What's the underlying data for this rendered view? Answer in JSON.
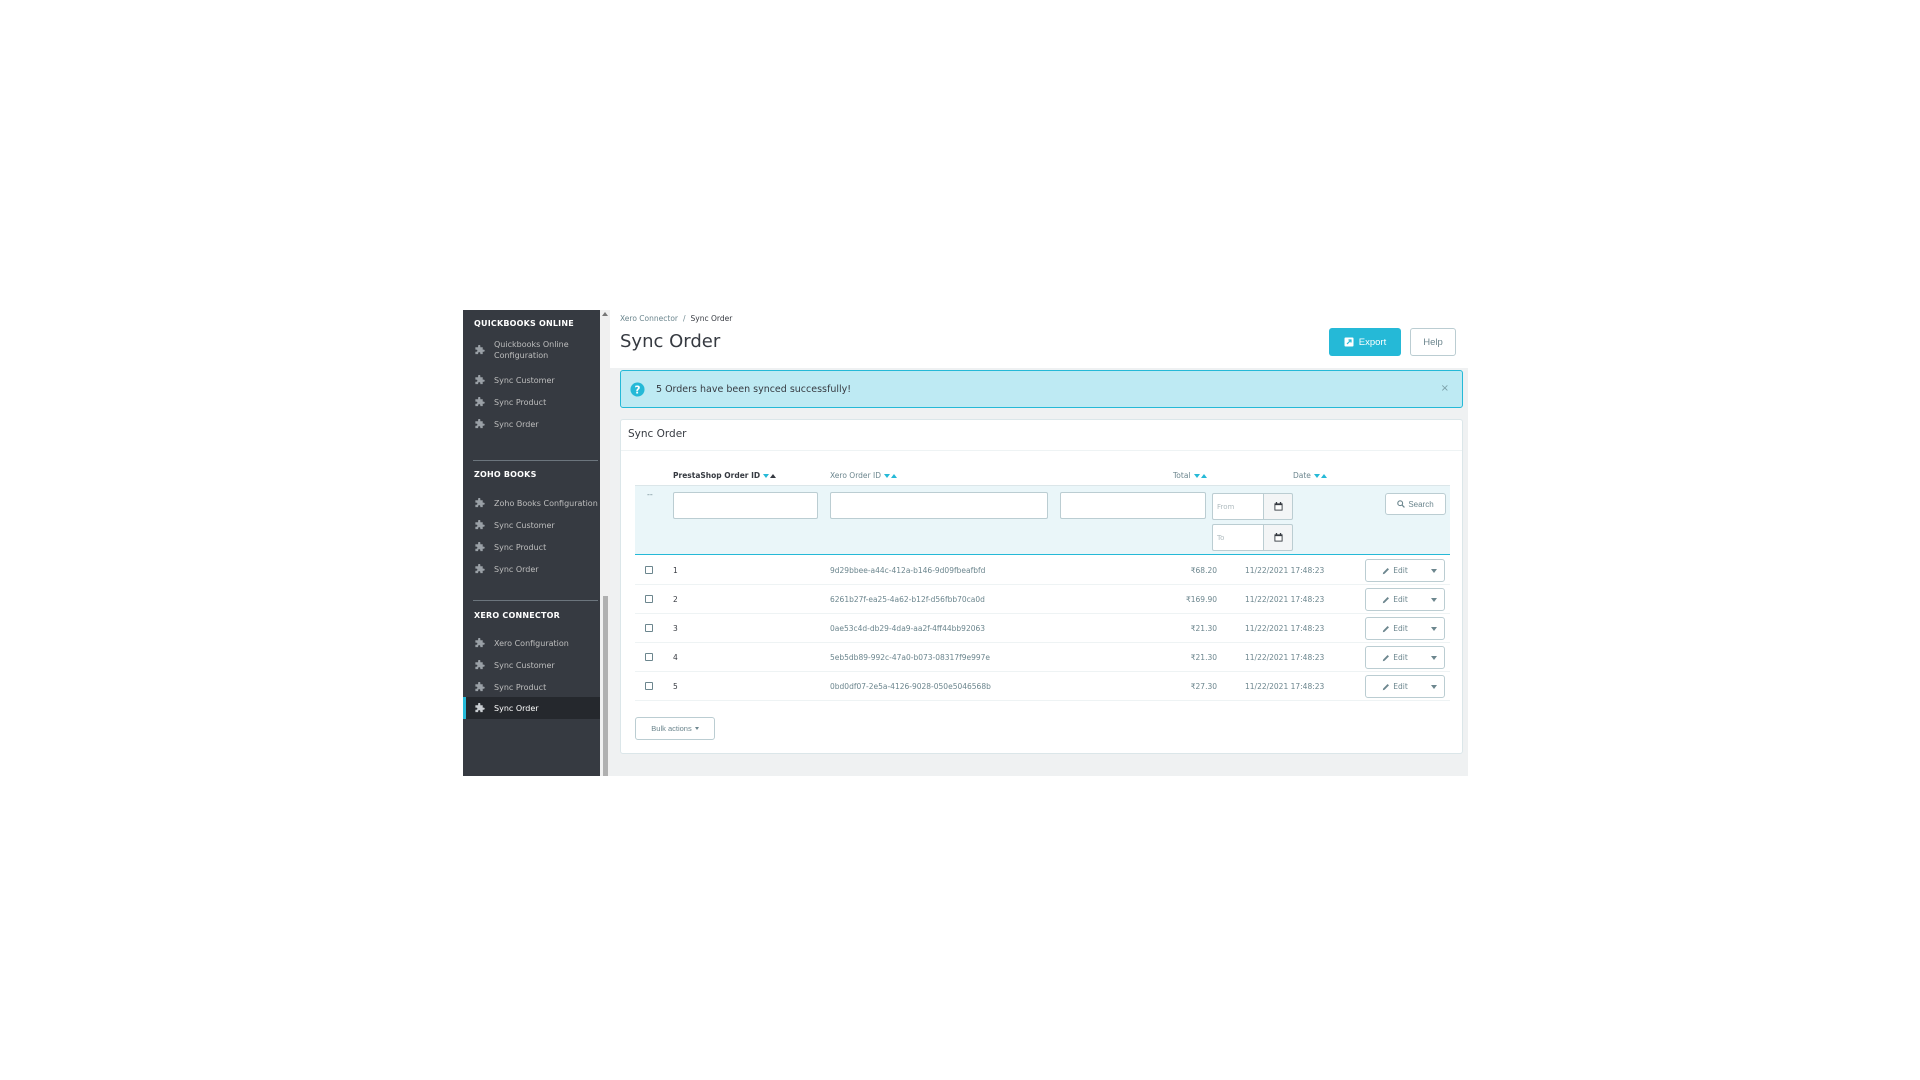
{
  "sidebar": {
    "sections": [
      {
        "title": "QUICKBOOKS ONLINE",
        "items": [
          {
            "label_line1": "Quickbooks Online",
            "label_line2": "Configuration"
          },
          {
            "label": "Sync Customer"
          },
          {
            "label": "Sync Product"
          },
          {
            "label": "Sync Order"
          }
        ]
      },
      {
        "title": "ZOHO BOOKS",
        "items": [
          {
            "label": "Zoho Books Configuration"
          },
          {
            "label": "Sync Customer"
          },
          {
            "label": "Sync Product"
          },
          {
            "label": "Sync Order"
          }
        ]
      },
      {
        "title": "XERO CONNECTOR",
        "items": [
          {
            "label": "Xero Configuration"
          },
          {
            "label": "Sync Customer"
          },
          {
            "label": "Sync Product"
          },
          {
            "label": "Sync Order",
            "active": true
          }
        ]
      }
    ]
  },
  "header": {
    "breadcrumb": {
      "parent": "Xero Connector",
      "separator": "/",
      "current": "Sync Order"
    },
    "title": "Sync Order",
    "export_label": "Export",
    "help_label": "Help"
  },
  "alert": {
    "message": "5 Orders have been synced successfully!",
    "close": "×",
    "icon": "question-circle-icon"
  },
  "panel": {
    "title": "Sync Order",
    "columns": {
      "order_id": "PrestaShop Order ID",
      "xero_id": "Xero Order ID",
      "total": "Total",
      "date": "Date"
    },
    "filters": {
      "dash": "--",
      "from_placeholder": "From",
      "to_placeholder": "To",
      "search_label": "Search"
    },
    "rows": [
      {
        "id": "1",
        "xero_id": "9d29bbee-a44c-412a-b146-9d09fbeafbfd",
        "total": "₹68.20",
        "date": "11/22/2021 17:48:23",
        "edit": "Edit"
      },
      {
        "id": "2",
        "xero_id": "6261b27f-ea25-4a62-b12f-d56fbb70ca0d",
        "total": "₹169.90",
        "date": "11/22/2021 17:48:23",
        "edit": "Edit"
      },
      {
        "id": "3",
        "xero_id": "0ae53c4d-db29-4da9-aa2f-4ff44bb92063",
        "total": "₹21.30",
        "date": "11/22/2021 17:48:23",
        "edit": "Edit"
      },
      {
        "id": "4",
        "xero_id": "5eb5db89-992c-47a0-b073-08317f9e997e",
        "total": "₹21.30",
        "date": "11/22/2021 17:48:23",
        "edit": "Edit"
      },
      {
        "id": "5",
        "xero_id": "0bd0df07-2e5a-4126-9028-050e5046568b",
        "total": "₹27.30",
        "date": "11/22/2021 17:48:23",
        "edit": "Edit"
      }
    ],
    "bulk_label": "Bulk actions"
  },
  "colors": {
    "accent": "#25b9d7",
    "sidebar_bg": "#363a41",
    "alert_bg": "#beeaf3"
  }
}
